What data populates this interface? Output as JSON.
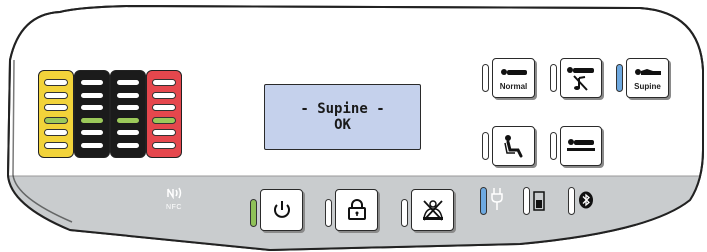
{
  "display": {
    "line1": "- Supine -",
    "line2": "OK"
  },
  "level_meter": {
    "columns": [
      {
        "color": "#f2d33a",
        "segments": 6,
        "lit_index": 3
      },
      {
        "color": "#1b1b1b",
        "segments": 6,
        "lit_index": 3
      },
      {
        "color": "#1b1b1b",
        "segments": 6,
        "lit_index": 3
      },
      {
        "color": "#e5474d",
        "segments": 6,
        "lit_index": 3
      }
    ],
    "lit_color": "#9cc95a"
  },
  "mode_buttons": {
    "normal_label": "Normal",
    "supine_label": "Supine",
    "supine_indicator": "on"
  },
  "bottom_bar": {
    "nfc_label": "NFC",
    "power_indicator": "on",
    "plug_indicator": "on"
  },
  "colors": {
    "indicator_blue": "#6ea9e0",
    "indicator_green": "#8fc158",
    "bottom_bar": "#c9ccce"
  }
}
